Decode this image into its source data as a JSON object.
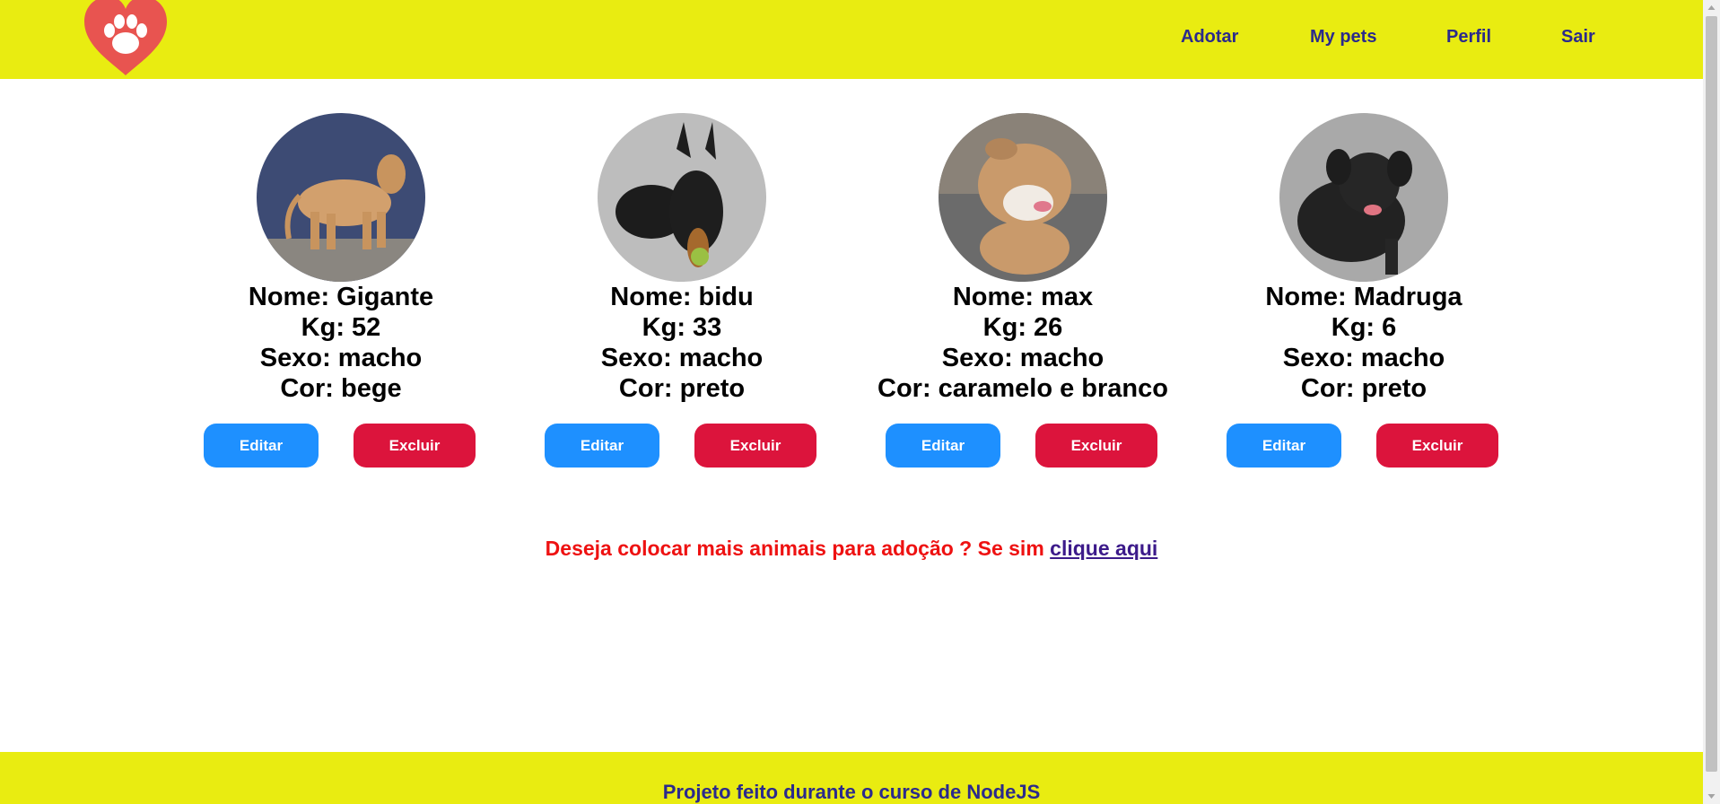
{
  "header": {
    "logo_icon": "heart-paw-icon",
    "nav": [
      {
        "label": "Adotar"
      },
      {
        "label": "My pets"
      },
      {
        "label": "Perfil"
      },
      {
        "label": "Sair"
      }
    ]
  },
  "pets": [
    {
      "nome_line": "Nome: Gigante",
      "kg_line": "Kg: 52",
      "sexo_line": "Sexo: macho",
      "cor_line": "Cor: bege",
      "edit_label": "Editar",
      "delete_label": "Excluir"
    },
    {
      "nome_line": "Nome: bidu",
      "kg_line": "Kg: 33",
      "sexo_line": "Sexo: macho",
      "cor_line": "Cor: preto",
      "edit_label": "Editar",
      "delete_label": "Excluir"
    },
    {
      "nome_line": "Nome: max",
      "kg_line": "Kg: 26",
      "sexo_line": "Sexo: macho",
      "cor_line": "Cor: caramelo e branco",
      "edit_label": "Editar",
      "delete_label": "Excluir"
    },
    {
      "nome_line": "Nome: Madruga",
      "kg_line": "Kg: 6",
      "sexo_line": "Sexo: macho",
      "cor_line": "Cor: preto",
      "edit_label": "Editar",
      "delete_label": "Excluir"
    }
  ],
  "cta": {
    "text": "Deseja colocar mais animais para adoção ? Se sim ",
    "link_label": "clique aqui"
  },
  "footer": {
    "text": "Projeto feito durante o curso de NodeJS"
  },
  "colors": {
    "header_bg": "#e9ec11",
    "nav_text": "#2b2a8c",
    "edit_button": "#1e90ff",
    "delete_button": "#dc143c",
    "cta_text": "#ee1111",
    "logo": "#e85450"
  }
}
